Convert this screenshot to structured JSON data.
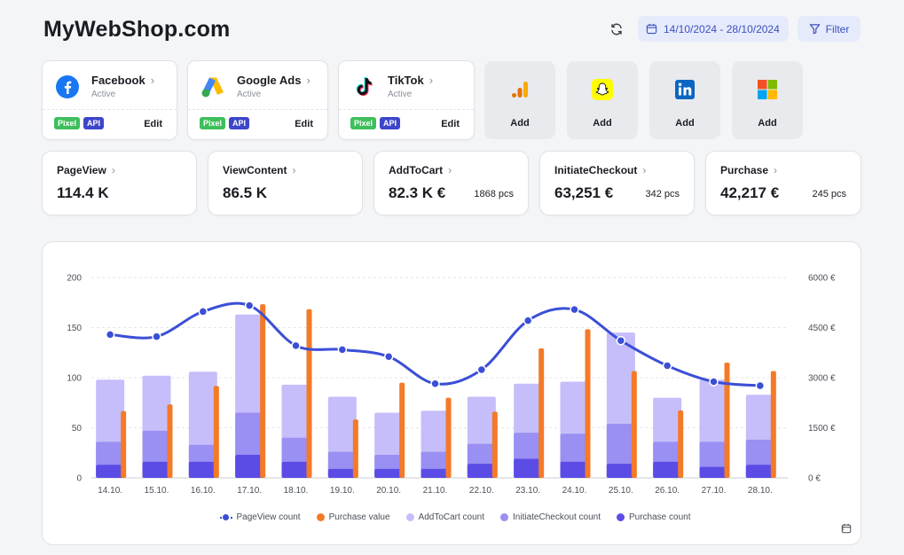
{
  "header": {
    "title": "MyWebShop.com",
    "date_range": "14/10/2024 - 28/10/2024",
    "filter_label": "Filter"
  },
  "platforms": [
    {
      "name": "Facebook",
      "status": "Active",
      "tags": [
        "Pixel",
        "API"
      ],
      "edit": "Edit",
      "icon": "facebook-icon"
    },
    {
      "name": "Google Ads",
      "status": "Active",
      "tags": [
        "Pixel",
        "API"
      ],
      "edit": "Edit",
      "icon": "google-ads-icon"
    },
    {
      "name": "TikTok",
      "status": "Active",
      "tags": [
        "Pixel",
        "API"
      ],
      "edit": "Edit",
      "icon": "tiktok-icon"
    }
  ],
  "add_cards": [
    {
      "label": "Add",
      "icon": "google-analytics-icon"
    },
    {
      "label": "Add",
      "icon": "snapchat-icon"
    },
    {
      "label": "Add",
      "icon": "linkedin-icon"
    },
    {
      "label": "Add",
      "icon": "microsoft-icon"
    }
  ],
  "metrics": [
    {
      "name": "PageView",
      "value": "114.4 K",
      "pcs": ""
    },
    {
      "name": "ViewContent",
      "value": "86.5 K",
      "pcs": ""
    },
    {
      "name": "AddToCart",
      "value": "82.3 K €",
      "pcs": "1868 pcs"
    },
    {
      "name": "InitiateCheckout",
      "value": "63,251 €",
      "pcs": "342 pcs"
    },
    {
      "name": "Purchase",
      "value": "42,217 €",
      "pcs": "245 pcs"
    }
  ],
  "colors": {
    "pageview": "#3b4fd6",
    "purchase_value": "#f47a28",
    "addtocart": "#c5befa",
    "initiatecheckout": "#9a8ff2",
    "purchase_count": "#5b4ce6"
  },
  "chart_data": {
    "type": "bar",
    "categories": [
      "14.10.",
      "15.10.",
      "16.10.",
      "17.10.",
      "18.10.",
      "19.10.",
      "20.10.",
      "21.10.",
      "22.10.",
      "23.10.",
      "24.10.",
      "25.10.",
      "26.10.",
      "27.10.",
      "28.10."
    ],
    "y_left_ticks": [
      "0",
      "50",
      "100",
      "150",
      "200"
    ],
    "y_right_ticks": [
      "0 €",
      "1500 €",
      "3000 €",
      "4500 €",
      "6000 €"
    ],
    "ylim_left": [
      0,
      200
    ],
    "ylim_right": [
      0,
      6000
    ],
    "series": [
      {
        "name": "PageView count",
        "type": "line",
        "axis": "left",
        "values": [
          143,
          141,
          166,
          172,
          132,
          128,
          121,
          94,
          108,
          157,
          168,
          137,
          112,
          96,
          92
        ]
      },
      {
        "name": "Purchase value",
        "type": "bar",
        "axis": "right",
        "values": [
          2000,
          2200,
          2750,
          5200,
          5050,
          1750,
          2850,
          2400,
          1980,
          3880,
          4450,
          3200,
          2020,
          3450,
          3200
        ]
      },
      {
        "name": "AddToCart count",
        "type": "bar",
        "axis": "left",
        "stack": "funnel",
        "values": [
          98,
          102,
          106,
          163,
          93,
          81,
          65,
          67,
          81,
          94,
          96,
          145,
          80,
          98,
          83
        ]
      },
      {
        "name": "InitiateCheckout count",
        "type": "bar",
        "axis": "left",
        "stack": "funnel",
        "values": [
          36,
          47,
          33,
          65,
          40,
          26,
          23,
          26,
          34,
          45,
          44,
          54,
          36,
          36,
          38
        ]
      },
      {
        "name": "Purchase count",
        "type": "bar",
        "axis": "left",
        "stack": "funnel",
        "values": [
          13,
          16,
          16,
          23,
          16,
          9,
          9,
          9,
          14,
          19,
          16,
          14,
          16,
          11,
          13
        ]
      }
    ],
    "legend": [
      "PageView count",
      "Purchase value",
      "AddToCart count",
      "InitiateCheckout count",
      "Purchase count"
    ],
    "grid": true,
    "legend_position": "bottom"
  }
}
